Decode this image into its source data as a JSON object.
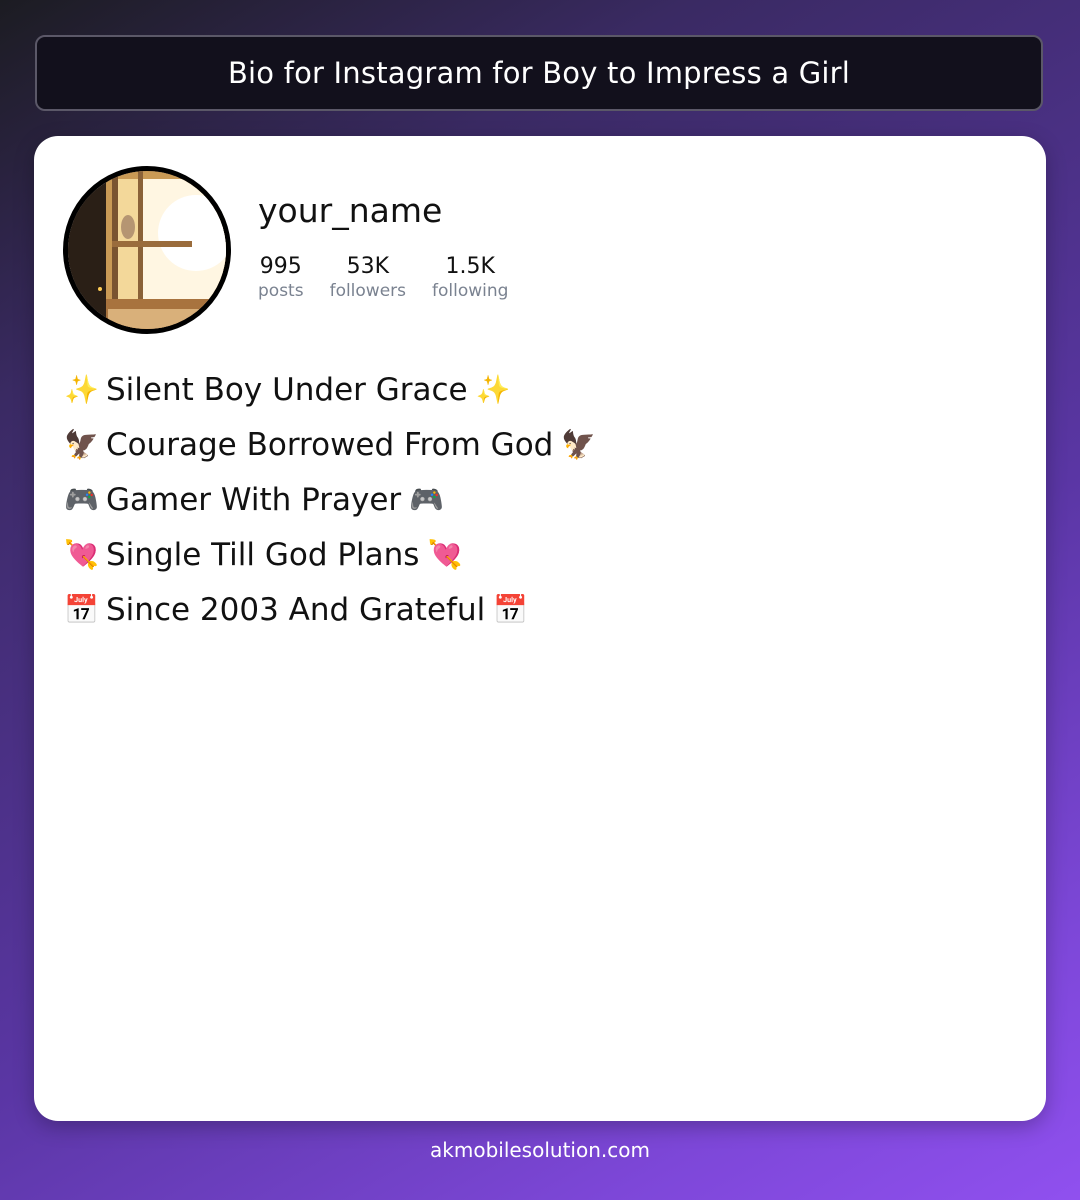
{
  "header": {
    "title": "Bio for Instagram for Boy to Impress a Girl"
  },
  "profile": {
    "username": "your_name",
    "avatar": "profile-photo",
    "stats": [
      {
        "value": "995",
        "label": "posts"
      },
      {
        "value": "53K",
        "label": "followers"
      },
      {
        "value": "1.5K",
        "label": "following"
      }
    ]
  },
  "bio": [
    {
      "emoji": "✨",
      "text": "Silent Boy Under Grace"
    },
    {
      "emoji": "🦅",
      "text": "Courage Borrowed From God"
    },
    {
      "emoji": "🎮",
      "text": "Gamer With Prayer"
    },
    {
      "emoji": "💘",
      "text": "Single Till God Plans"
    },
    {
      "emoji": "📅",
      "text": "Since 2003 And Grateful"
    }
  ],
  "footer": {
    "site": "akmobilesolution.com"
  }
}
